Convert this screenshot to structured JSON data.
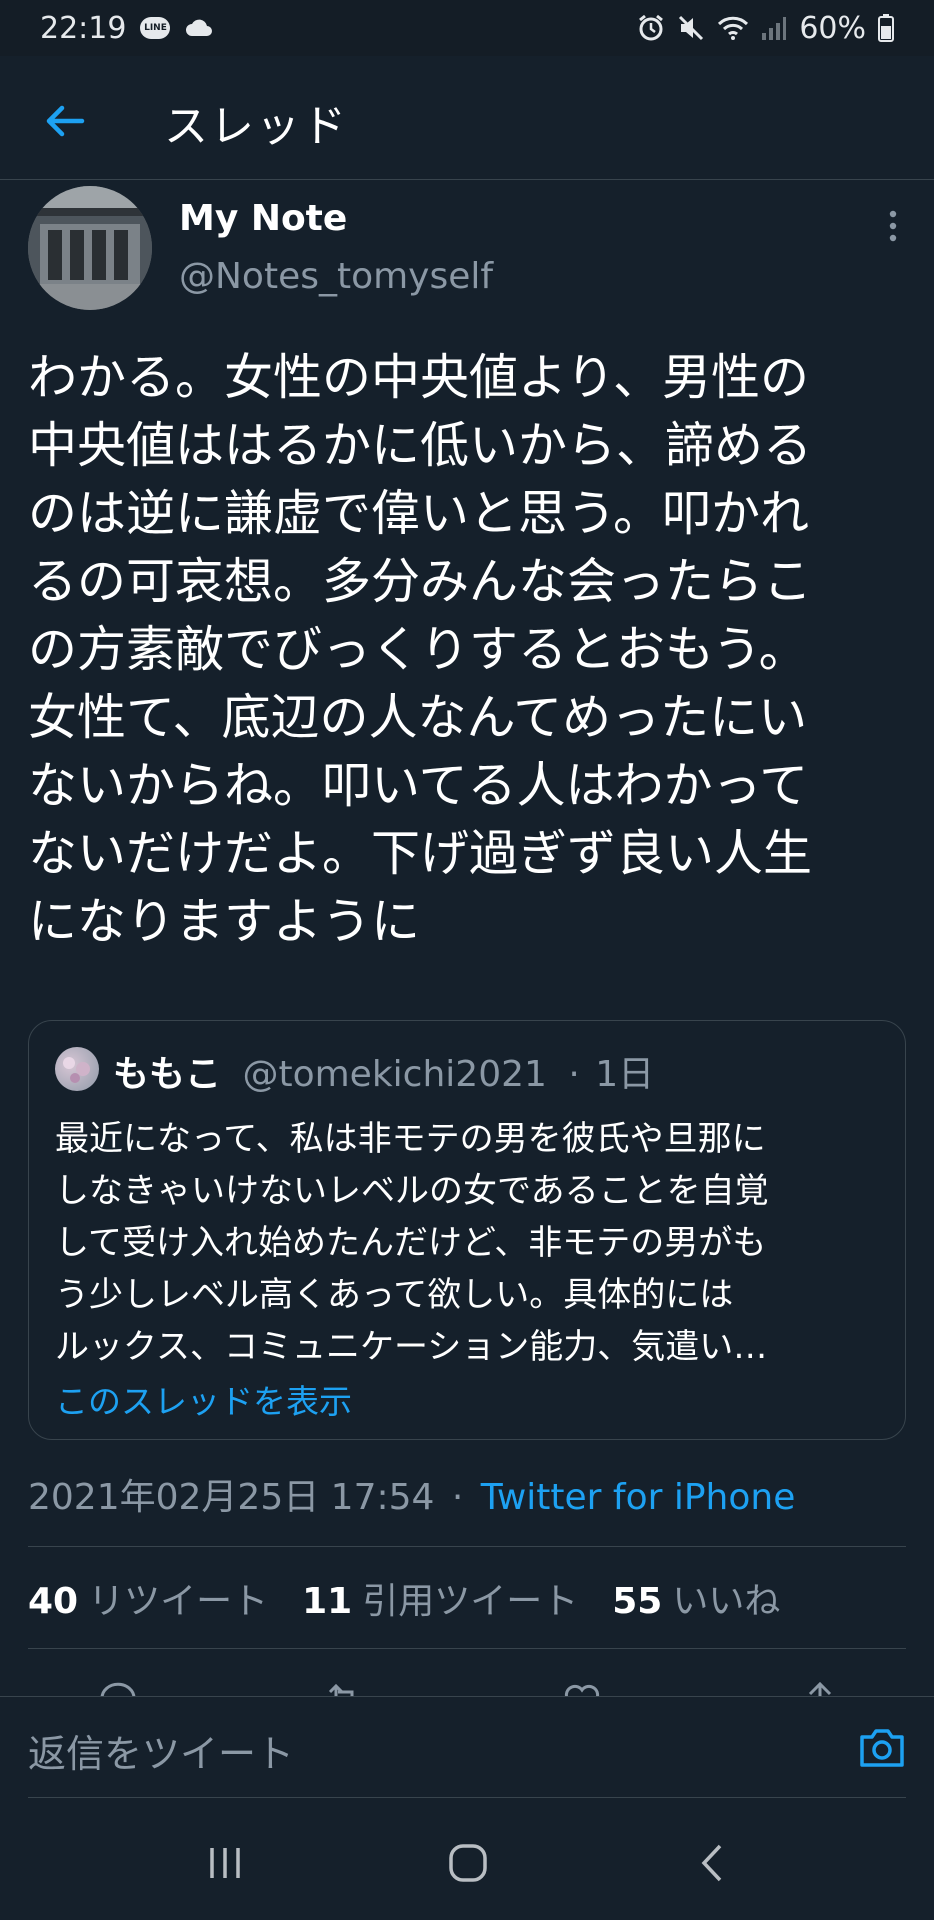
{
  "status_bar": {
    "time": "22:19",
    "line_badge": "LINE",
    "battery": "60%",
    "icons": [
      "line-icon",
      "cloud-icon",
      "alarm-icon",
      "mute-icon",
      "wifi-icon",
      "signal-icon",
      "battery-icon"
    ]
  },
  "header": {
    "title": "スレッド",
    "back_icon": "arrow-left-icon"
  },
  "tweet": {
    "author_name": "My Note",
    "author_handle": "@Notes_tomyself",
    "text": "わかる。女性の中央値より、男性の\n中央値ははるかに低いから、諦める\nのは逆に謙虚で偉いと思う。叩かれ\nるの可哀想。多分みんな会ったらこ\nの方素敵でびっくりするとおもう。\n女性て、底辺の人なんてめったにい\nないからね。叩いてる人はわかって\nないだけだよ。下げ過ぎず良い人生\nになりますように",
    "timestamp": "2021年02月25日 17:54",
    "separator": "·",
    "source": "Twitter for iPhone"
  },
  "quote": {
    "name": "ももこ",
    "handle": "@tomekichi2021",
    "dot": "·",
    "age": "1日",
    "text": "最近になって、私は非モテの男を彼氏や旦那に\nしなきゃいけないレベルの女であることを自覚\nして受け入れ始めたんだけど、非モテの男がも\nう少しレベル高くあって欲しい。具体的には\nルックス、コミュニケーション能力、気遣い…",
    "show_thread": "このスレッドを表示"
  },
  "stats": {
    "retweets_count": "40",
    "retweets_label": "リツイート",
    "quotes_count": "11",
    "quotes_label": "引用ツイート",
    "likes_count": "55",
    "likes_label": "いいね"
  },
  "reply": {
    "placeholder": "返信をツイート",
    "camera_icon": "camera-icon"
  },
  "colors": {
    "background": "#15202b",
    "accent": "#1da1f2",
    "secondary_text": "#8b98a5",
    "border": "#38444d"
  }
}
